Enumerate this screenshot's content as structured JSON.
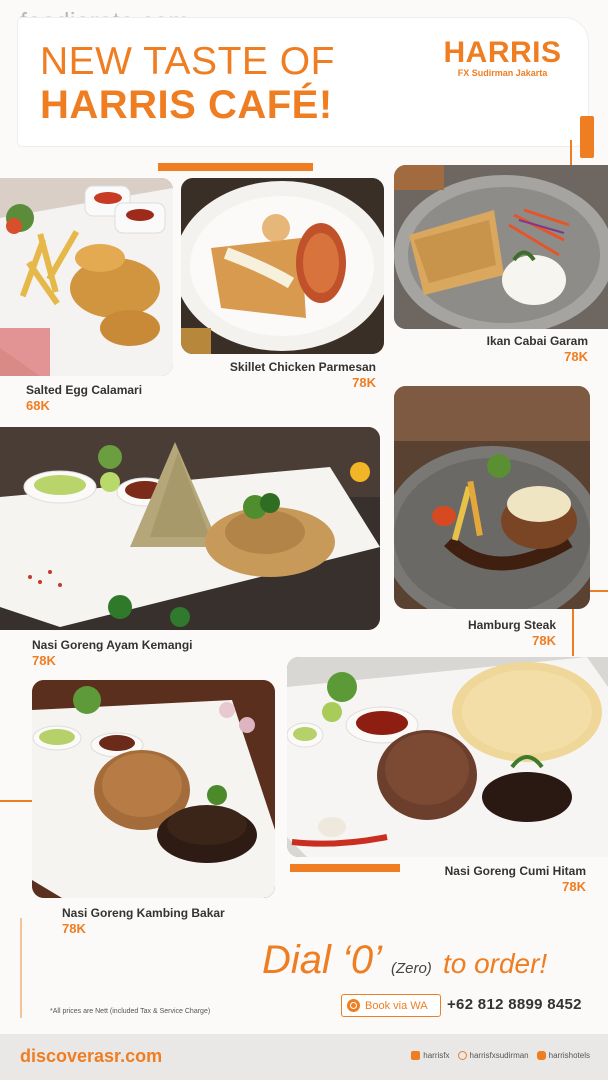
{
  "watermark": "foodierate.com",
  "header": {
    "title_line1": "NEW TASTE OF",
    "title_line2": "HARRIS CAFÉ!",
    "brand_name": "HARRIS",
    "brand_location": "FX Sudirman Jakarta"
  },
  "dishes": [
    {
      "name": "Salted Egg Calamari",
      "price": "68K"
    },
    {
      "name": "Skillet Chicken Parmesan",
      "price": "78K"
    },
    {
      "name": "Ikan Cabai Garam",
      "price": "78K"
    },
    {
      "name": "Nasi Goreng Ayam Kemangi",
      "price": "78K"
    },
    {
      "name": "Hamburg Steak",
      "price": "78K"
    },
    {
      "name": "Nasi Goreng Kambing Bakar",
      "price": "78K"
    },
    {
      "name": "Nasi Goreng Cumi Hitam",
      "price": "78K"
    }
  ],
  "order": {
    "dial_main": "Dial ‘0’",
    "dial_zero": "(Zero)",
    "dial_rest": "to order!",
    "note": "*All prices are Nett (included Tax & Service Charge)",
    "wa_button": "Book via WA",
    "phone": "+62 812 8899 8452"
  },
  "footer": {
    "site": "discoverasr.com",
    "facebook": "harrisfx",
    "instagram": "harrisfxsudirman",
    "youtube": "harrishotels"
  },
  "colors": {
    "accent": "#ef7d22",
    "text": "#333333",
    "footer_bg": "#e9e8e6"
  }
}
